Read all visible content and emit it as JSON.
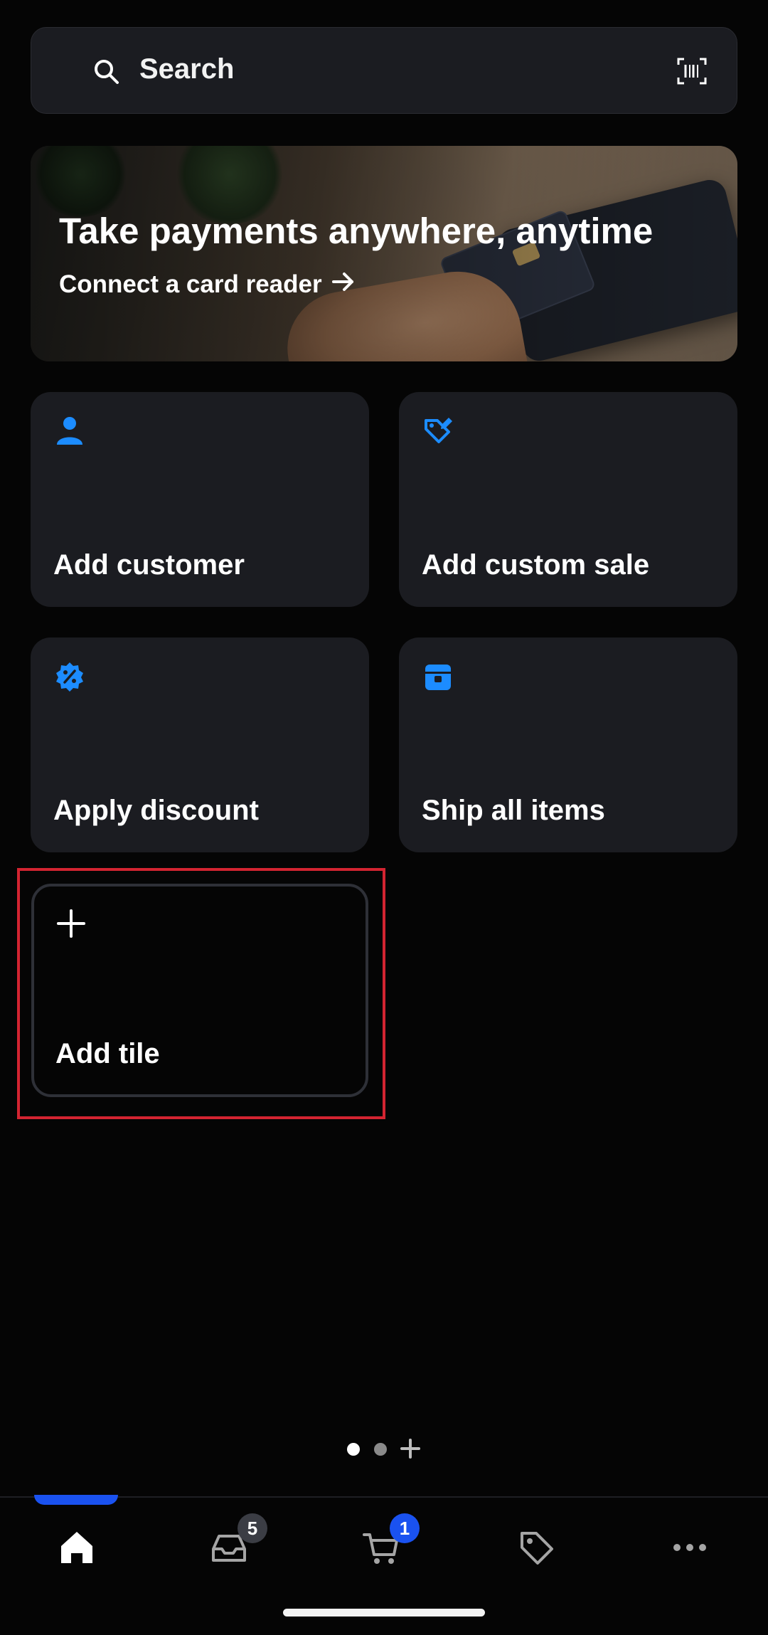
{
  "search": {
    "label": "Search"
  },
  "banner": {
    "title": "Take payments anywhere, anytime",
    "link_label": "Connect a card reader"
  },
  "tiles": [
    {
      "label": "Add customer",
      "icon": "person-icon"
    },
    {
      "label": "Add custom sale",
      "icon": "tag-edit-icon"
    },
    {
      "label": "Apply discount",
      "icon": "discount-badge-icon"
    },
    {
      "label": "Ship all items",
      "icon": "shipping-box-icon"
    }
  ],
  "add_tile": {
    "label": "Add tile",
    "icon": "plus-icon"
  },
  "pager": {
    "pages": 2,
    "active": 1
  },
  "nav": {
    "items": [
      {
        "name": "home",
        "icon": "home-icon"
      },
      {
        "name": "inbox",
        "icon": "inbox-icon",
        "badge": "5"
      },
      {
        "name": "cart",
        "icon": "cart-icon",
        "badge": "1"
      },
      {
        "name": "items",
        "icon": "tag-icon"
      },
      {
        "name": "more",
        "icon": "more-icon"
      }
    ]
  },
  "colors": {
    "accent": "#1a52f0",
    "icon_blue": "#1c8cff",
    "tile_bg": "#1b1c21",
    "highlight": "#d32431"
  }
}
